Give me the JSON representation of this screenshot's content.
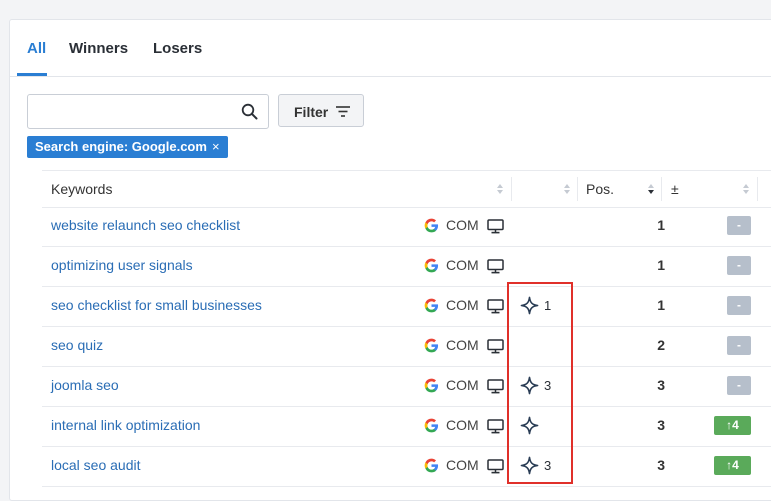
{
  "tabs": [
    {
      "label": "All",
      "active": true
    },
    {
      "label": "Winners",
      "active": false
    },
    {
      "label": "Losers",
      "active": false
    }
  ],
  "search": {
    "value": "",
    "placeholder": ""
  },
  "filter_button": {
    "label": "Filter"
  },
  "active_filter": {
    "label": "Search engine: Google.com",
    "remove": "×"
  },
  "table": {
    "headers": {
      "keywords": "Keywords",
      "ai": "",
      "pos": "Pos.",
      "change": "±"
    },
    "rows": [
      {
        "keyword": "website relaunch seo checklist",
        "domain": "COM",
        "ai": false,
        "ai_num": "",
        "pos": "1",
        "change": "-",
        "change_type": "neutral"
      },
      {
        "keyword": "optimizing user signals",
        "domain": "COM",
        "ai": false,
        "ai_num": "",
        "pos": "1",
        "change": "-",
        "change_type": "neutral"
      },
      {
        "keyword": "seo checklist for small businesses",
        "domain": "COM",
        "ai": true,
        "ai_num": "1",
        "pos": "1",
        "change": "-",
        "change_type": "neutral"
      },
      {
        "keyword": "seo quiz",
        "domain": "COM",
        "ai": false,
        "ai_num": "",
        "pos": "2",
        "change": "-",
        "change_type": "neutral"
      },
      {
        "keyword": "joomla seo",
        "domain": "COM",
        "ai": true,
        "ai_num": "3",
        "pos": "3",
        "change": "-",
        "change_type": "neutral"
      },
      {
        "keyword": "internal link optimization",
        "domain": "COM",
        "ai": true,
        "ai_num": "",
        "pos": "3",
        "change": "↑4",
        "change_type": "up"
      },
      {
        "keyword": "local seo audit",
        "domain": "COM",
        "ai": true,
        "ai_num": "3",
        "pos": "3",
        "change": "↑4",
        "change_type": "up"
      }
    ]
  },
  "colors": {
    "accent": "#2a7ed3",
    "link": "#2a6db5",
    "up": "#5aaa5a",
    "neutral": "#b6bfcb",
    "highlight": "#e0302a"
  },
  "icons": {
    "search": "search-icon",
    "filter": "filter-lines-icon",
    "engine": "google-icon",
    "device": "desktop-icon",
    "ai": "ai-sparkle-icon",
    "sort": "sort-icon"
  }
}
